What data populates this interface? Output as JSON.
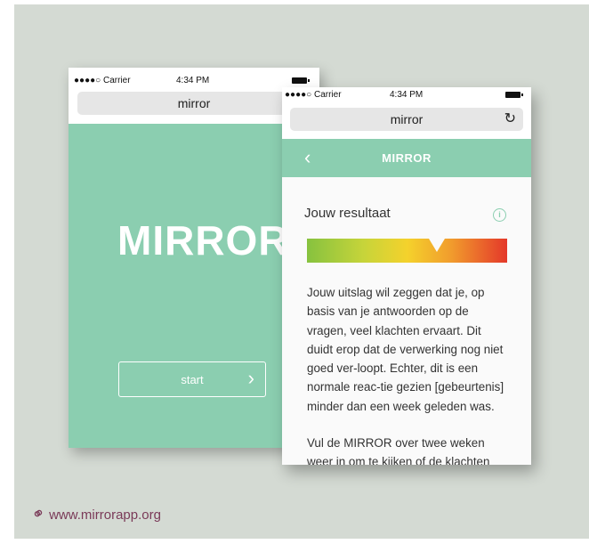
{
  "phone1": {
    "status": {
      "signal": "●●●●○ Carrier",
      "wifi": "wifi-icon",
      "time": "4:34 PM"
    },
    "url": "mirror",
    "logo": "MIRROR",
    "start_label": "start",
    "start_chevron": "›"
  },
  "phone2": {
    "status": {
      "signal": "●●●●○ Carrier",
      "wifi": "wifi-icon",
      "time": "4:34 PM"
    },
    "url": "mirror",
    "reload": "↻",
    "header": {
      "back": "‹",
      "title": "MIRROR"
    },
    "result_title": "Jouw resultaat",
    "info": "i",
    "gauge_value_percent": 65,
    "paragraph1": "Jouw uitslag wil zeggen dat je, op basis van je antwoorden op de vragen, veel klachten ervaart. Dit duidt erop dat de verwerking nog niet goed ver-loopt. Echter, dit is een normale reac-tie gezien [gebeurtenis] minder dan een week geleden was.",
    "paragraph2": "Vul de MIRROR over twee weken weer in om te kijken of de klachten minder"
  },
  "link": {
    "text": "www.mirrorapp.org",
    "icon": "link-icon"
  },
  "colors": {
    "background": "#d4dad3",
    "accent": "#8bceb0",
    "link": "#7a3a58"
  }
}
